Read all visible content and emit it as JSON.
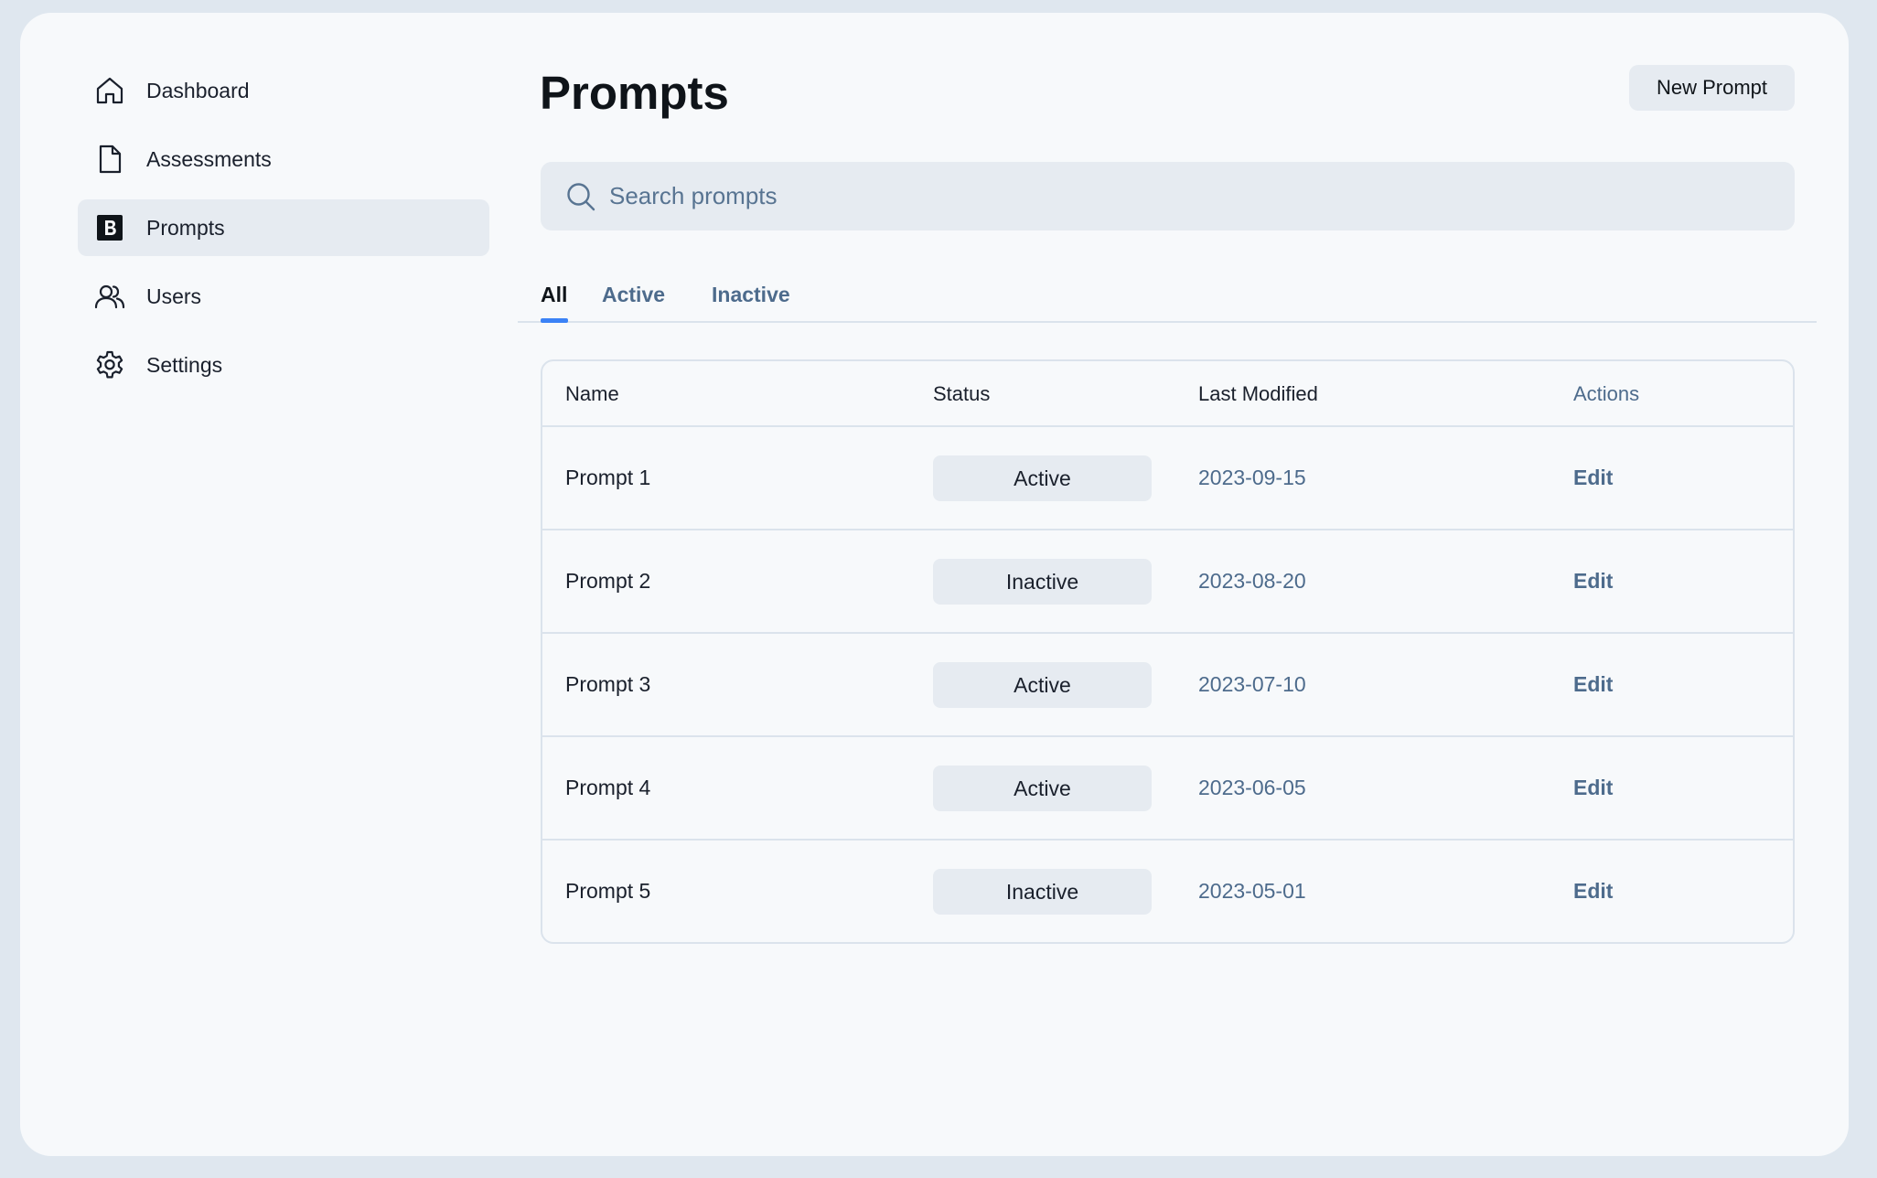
{
  "sidebar": {
    "items": [
      {
        "label": "Dashboard",
        "icon": "home-icon",
        "active": false
      },
      {
        "label": "Assessments",
        "icon": "file-icon",
        "active": false
      },
      {
        "label": "Prompts",
        "icon": "b-square-icon",
        "active": true
      },
      {
        "label": "Users",
        "icon": "users-icon",
        "active": false
      },
      {
        "label": "Settings",
        "icon": "gear-icon",
        "active": false
      }
    ]
  },
  "header": {
    "title": "Prompts",
    "new_button_label": "New Prompt"
  },
  "search": {
    "placeholder": "Search prompts",
    "value": ""
  },
  "tabs": [
    {
      "label": "All",
      "active": true
    },
    {
      "label": "Active",
      "active": false
    },
    {
      "label": "Inactive",
      "active": false
    }
  ],
  "table": {
    "columns": [
      "Name",
      "Status",
      "Last Modified",
      "Actions"
    ],
    "rows": [
      {
        "name": "Prompt 1",
        "status": "Active",
        "last_modified": "2023-09-15",
        "action": "Edit"
      },
      {
        "name": "Prompt 2",
        "status": "Inactive",
        "last_modified": "2023-08-20",
        "action": "Edit"
      },
      {
        "name": "Prompt 3",
        "status": "Active",
        "last_modified": "2023-07-10",
        "action": "Edit"
      },
      {
        "name": "Prompt 4",
        "status": "Active",
        "last_modified": "2023-06-05",
        "action": "Edit"
      },
      {
        "name": "Prompt 5",
        "status": "Inactive",
        "last_modified": "2023-05-01",
        "action": "Edit"
      }
    ]
  },
  "colors": {
    "background": "#dfe7ef",
    "window": "#f7f9fb",
    "surface": "#e6ebf1",
    "accent": "#3b82f6",
    "muted_text": "#4d6b8c",
    "border": "#dbe3ec"
  }
}
